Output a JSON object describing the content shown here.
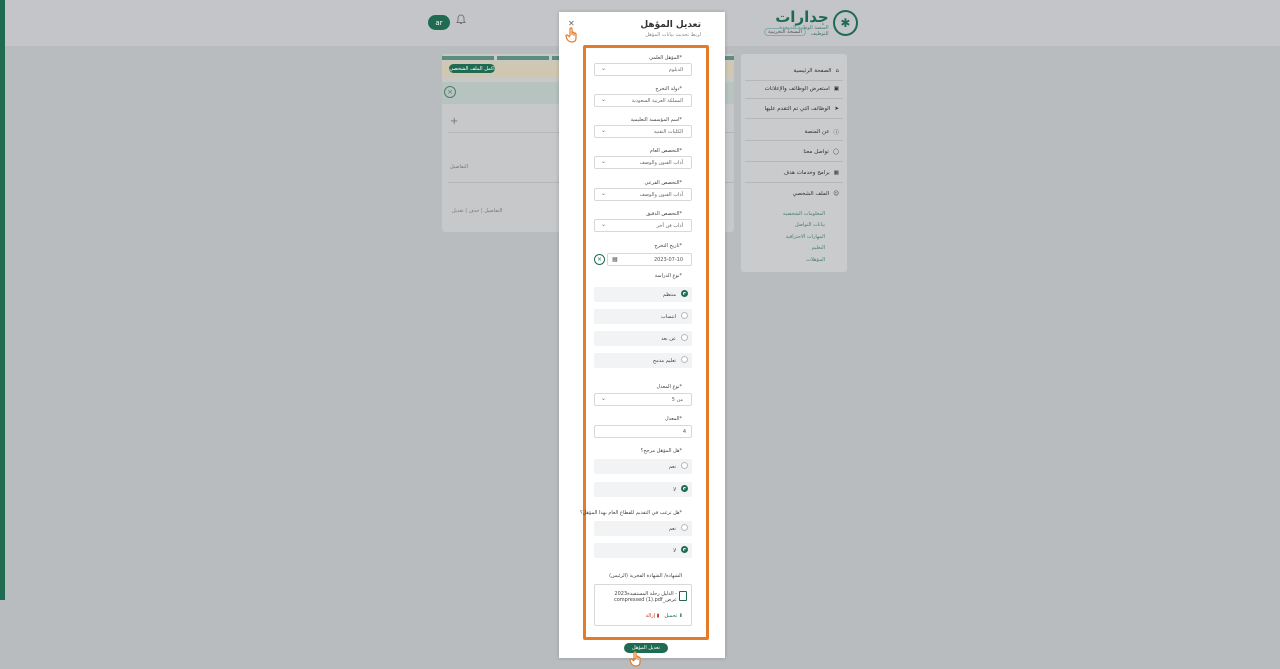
{
  "header": {
    "logo_text": "جدارات",
    "logo_sub": "المنصة الوطنية الموحدة للتوظيف",
    "logo_pill": "النسخة التجريبية",
    "lang_label": "ar"
  },
  "sidebar": {
    "items": [
      {
        "label": "الصفحة الرئيسية",
        "icon": "home-icon"
      },
      {
        "label": "استعرض الوظائف والإعلانات",
        "icon": "briefcase-icon"
      },
      {
        "label": "الوظائف التي تم التقدم عليها",
        "icon": "send-icon"
      },
      {
        "label": "عن المنصة",
        "icon": "info-icon"
      },
      {
        "label": "تواصل معنا",
        "icon": "chat-icon"
      },
      {
        "label": "برامج وخدمات هدف",
        "icon": "grid-icon"
      },
      {
        "label": "الملف الشخصي",
        "icon": "user-icon"
      }
    ],
    "sub_items": [
      "المعلومات الشخصية",
      "بيانات التواصل",
      "المهارات الاحترافية",
      "التعليم",
      "المؤهلات"
    ]
  },
  "background_panel": {
    "banner_button": "اكمل الملف الشخصي",
    "row_label": "التفاصيل",
    "links": "التفاصيل | حذف | تعديل"
  },
  "modal": {
    "title": "تعديل المؤهل",
    "subtitle": "لربط تحديث بيانات المؤهل",
    "fields": {
      "degree": {
        "label": "المؤهل العلمي*",
        "value": "الدبلوم"
      },
      "grad_country": {
        "label": "دولة التخرج*",
        "value": "المملكة العربية السعودية"
      },
      "institution": {
        "label": "اسم المؤسسة التعليمية*",
        "value": "الكليات التقنية"
      },
      "general_major": {
        "label": "التخصص العام*",
        "value": "آداب الفنون والوصف"
      },
      "sub_major": {
        "label": "التخصص الفرعي*",
        "value": "آداب الفنون والوصف"
      },
      "precise_major": {
        "label": "التخصص الدقيق*",
        "value": "آداب فن آخر"
      },
      "grad_date": {
        "label": "تاريخ التخرج*",
        "value": "2023-07-10"
      },
      "study_type": {
        "label": "نوع الدراسة*",
        "options": [
          "منتظم",
          "انتساب",
          "عن بعد",
          "تعليم مدمج"
        ],
        "selected": 0
      },
      "gpa_type": {
        "label": "نوع المعدل*",
        "value": "من 5"
      },
      "gpa": {
        "label": "المعدل*",
        "value": "4"
      },
      "is_verified": {
        "label": "هل المؤهل مرجح؟*",
        "options": [
          "نعم",
          "لا"
        ],
        "selected": 1
      },
      "public_sector": {
        "label": "هل ترغب في التقديم للقطاع العام بهذا المؤهل؟*",
        "options": [
          "نعم",
          "لا"
        ],
        "selected": 1
      },
      "certificate": {
        "label": "الشهادة/ الشهادة الفخرية (الرئيس)",
        "file_name": "2023الدليل رحلة المستفيدة - compressed (1).pdf_عرض",
        "download_label": "تحميل",
        "delete_label": "إزالة"
      }
    },
    "submit_label": "تعديل المؤهل"
  },
  "colors": {
    "brand": "#1f6b52",
    "highlight": "#e37b28"
  }
}
